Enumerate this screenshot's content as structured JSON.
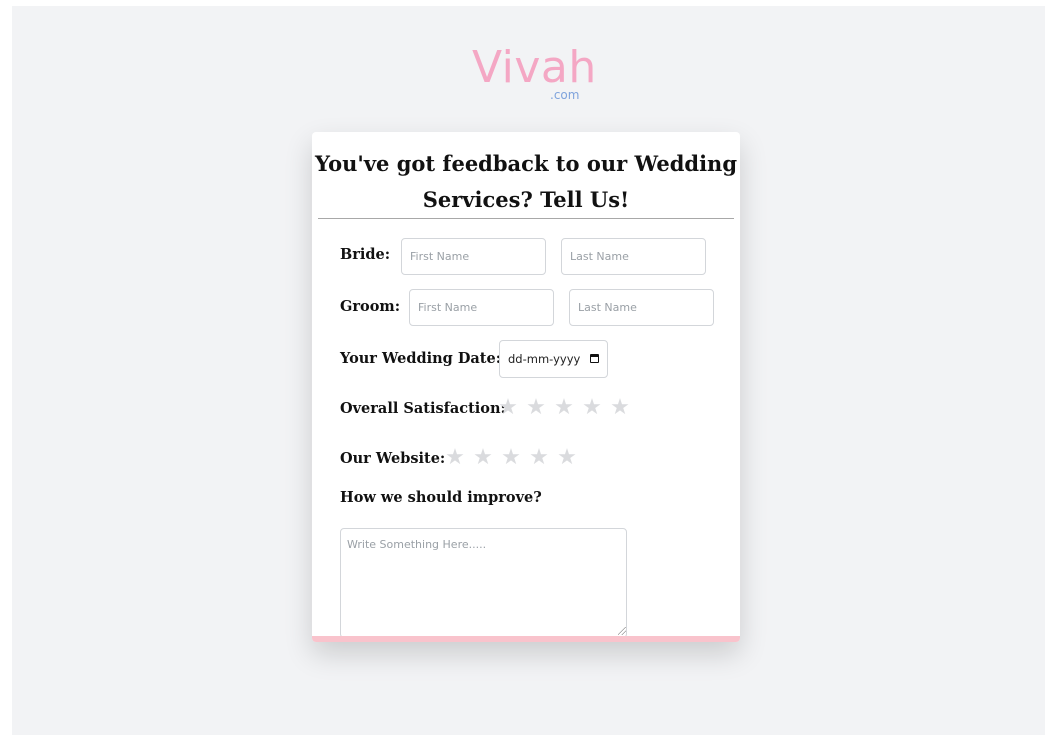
{
  "brand": {
    "name": "Vivah",
    "suffix": ".com",
    "primary_color": "#f4a7c4",
    "suffix_color": "#7fa3dc"
  },
  "form": {
    "title": "You've got feedback to our Wedding Services? Tell Us!",
    "bride": {
      "label": "Bride:",
      "first_placeholder": "First Name",
      "last_placeholder": "Last Name"
    },
    "groom": {
      "label": "Groom:",
      "first_placeholder": "First Name",
      "last_placeholder": "Last Name"
    },
    "wedding_date": {
      "label": "Your Wedding Date:",
      "placeholder": "dd-mm-yyyy",
      "icon": "calendar-icon"
    },
    "overall_satisfaction": {
      "label": "Overall Satisfaction:",
      "max_stars": 5,
      "rating": 0
    },
    "website": {
      "label": "Our Website:",
      "max_stars": 5,
      "rating": 0
    },
    "improve": {
      "label": "How we should improve?",
      "placeholder": "Write Something Here....."
    },
    "accent_bar_color": "#f9c3cc",
    "star_empty_color": "#dadbde"
  }
}
